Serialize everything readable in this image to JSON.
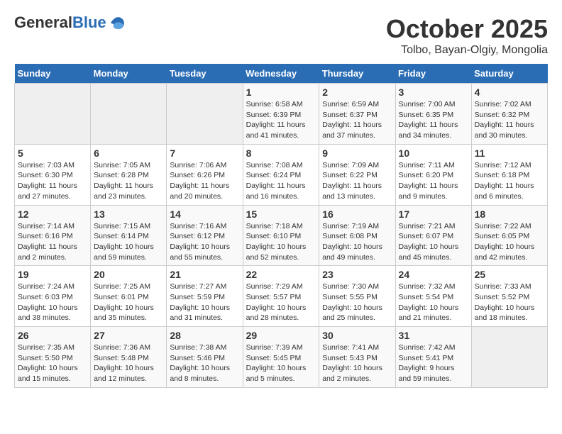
{
  "header": {
    "logo_general": "General",
    "logo_blue": "Blue",
    "month": "October 2025",
    "location": "Tolbo, Bayan-Olgiy, Mongolia"
  },
  "days_of_week": [
    "Sunday",
    "Monday",
    "Tuesday",
    "Wednesday",
    "Thursday",
    "Friday",
    "Saturday"
  ],
  "weeks": [
    [
      {
        "day": "",
        "info": ""
      },
      {
        "day": "",
        "info": ""
      },
      {
        "day": "",
        "info": ""
      },
      {
        "day": "1",
        "info": "Sunrise: 6:58 AM\nSunset: 6:39 PM\nDaylight: 11 hours\nand 41 minutes."
      },
      {
        "day": "2",
        "info": "Sunrise: 6:59 AM\nSunset: 6:37 PM\nDaylight: 11 hours\nand 37 minutes."
      },
      {
        "day": "3",
        "info": "Sunrise: 7:00 AM\nSunset: 6:35 PM\nDaylight: 11 hours\nand 34 minutes."
      },
      {
        "day": "4",
        "info": "Sunrise: 7:02 AM\nSunset: 6:32 PM\nDaylight: 11 hours\nand 30 minutes."
      }
    ],
    [
      {
        "day": "5",
        "info": "Sunrise: 7:03 AM\nSunset: 6:30 PM\nDaylight: 11 hours\nand 27 minutes."
      },
      {
        "day": "6",
        "info": "Sunrise: 7:05 AM\nSunset: 6:28 PM\nDaylight: 11 hours\nand 23 minutes."
      },
      {
        "day": "7",
        "info": "Sunrise: 7:06 AM\nSunset: 6:26 PM\nDaylight: 11 hours\nand 20 minutes."
      },
      {
        "day": "8",
        "info": "Sunrise: 7:08 AM\nSunset: 6:24 PM\nDaylight: 11 hours\nand 16 minutes."
      },
      {
        "day": "9",
        "info": "Sunrise: 7:09 AM\nSunset: 6:22 PM\nDaylight: 11 hours\nand 13 minutes."
      },
      {
        "day": "10",
        "info": "Sunrise: 7:11 AM\nSunset: 6:20 PM\nDaylight: 11 hours\nand 9 minutes."
      },
      {
        "day": "11",
        "info": "Sunrise: 7:12 AM\nSunset: 6:18 PM\nDaylight: 11 hours\nand 6 minutes."
      }
    ],
    [
      {
        "day": "12",
        "info": "Sunrise: 7:14 AM\nSunset: 6:16 PM\nDaylight: 11 hours\nand 2 minutes."
      },
      {
        "day": "13",
        "info": "Sunrise: 7:15 AM\nSunset: 6:14 PM\nDaylight: 10 hours\nand 59 minutes."
      },
      {
        "day": "14",
        "info": "Sunrise: 7:16 AM\nSunset: 6:12 PM\nDaylight: 10 hours\nand 55 minutes."
      },
      {
        "day": "15",
        "info": "Sunrise: 7:18 AM\nSunset: 6:10 PM\nDaylight: 10 hours\nand 52 minutes."
      },
      {
        "day": "16",
        "info": "Sunrise: 7:19 AM\nSunset: 6:08 PM\nDaylight: 10 hours\nand 49 minutes."
      },
      {
        "day": "17",
        "info": "Sunrise: 7:21 AM\nSunset: 6:07 PM\nDaylight: 10 hours\nand 45 minutes."
      },
      {
        "day": "18",
        "info": "Sunrise: 7:22 AM\nSunset: 6:05 PM\nDaylight: 10 hours\nand 42 minutes."
      }
    ],
    [
      {
        "day": "19",
        "info": "Sunrise: 7:24 AM\nSunset: 6:03 PM\nDaylight: 10 hours\nand 38 minutes."
      },
      {
        "day": "20",
        "info": "Sunrise: 7:25 AM\nSunset: 6:01 PM\nDaylight: 10 hours\nand 35 minutes."
      },
      {
        "day": "21",
        "info": "Sunrise: 7:27 AM\nSunset: 5:59 PM\nDaylight: 10 hours\nand 31 minutes."
      },
      {
        "day": "22",
        "info": "Sunrise: 7:29 AM\nSunset: 5:57 PM\nDaylight: 10 hours\nand 28 minutes."
      },
      {
        "day": "23",
        "info": "Sunrise: 7:30 AM\nSunset: 5:55 PM\nDaylight: 10 hours\nand 25 minutes."
      },
      {
        "day": "24",
        "info": "Sunrise: 7:32 AM\nSunset: 5:54 PM\nDaylight: 10 hours\nand 21 minutes."
      },
      {
        "day": "25",
        "info": "Sunrise: 7:33 AM\nSunset: 5:52 PM\nDaylight: 10 hours\nand 18 minutes."
      }
    ],
    [
      {
        "day": "26",
        "info": "Sunrise: 7:35 AM\nSunset: 5:50 PM\nDaylight: 10 hours\nand 15 minutes."
      },
      {
        "day": "27",
        "info": "Sunrise: 7:36 AM\nSunset: 5:48 PM\nDaylight: 10 hours\nand 12 minutes."
      },
      {
        "day": "28",
        "info": "Sunrise: 7:38 AM\nSunset: 5:46 PM\nDaylight: 10 hours\nand 8 minutes."
      },
      {
        "day": "29",
        "info": "Sunrise: 7:39 AM\nSunset: 5:45 PM\nDaylight: 10 hours\nand 5 minutes."
      },
      {
        "day": "30",
        "info": "Sunrise: 7:41 AM\nSunset: 5:43 PM\nDaylight: 10 hours\nand 2 minutes."
      },
      {
        "day": "31",
        "info": "Sunrise: 7:42 AM\nSunset: 5:41 PM\nDaylight: 9 hours\nand 59 minutes."
      },
      {
        "day": "",
        "info": ""
      }
    ]
  ]
}
